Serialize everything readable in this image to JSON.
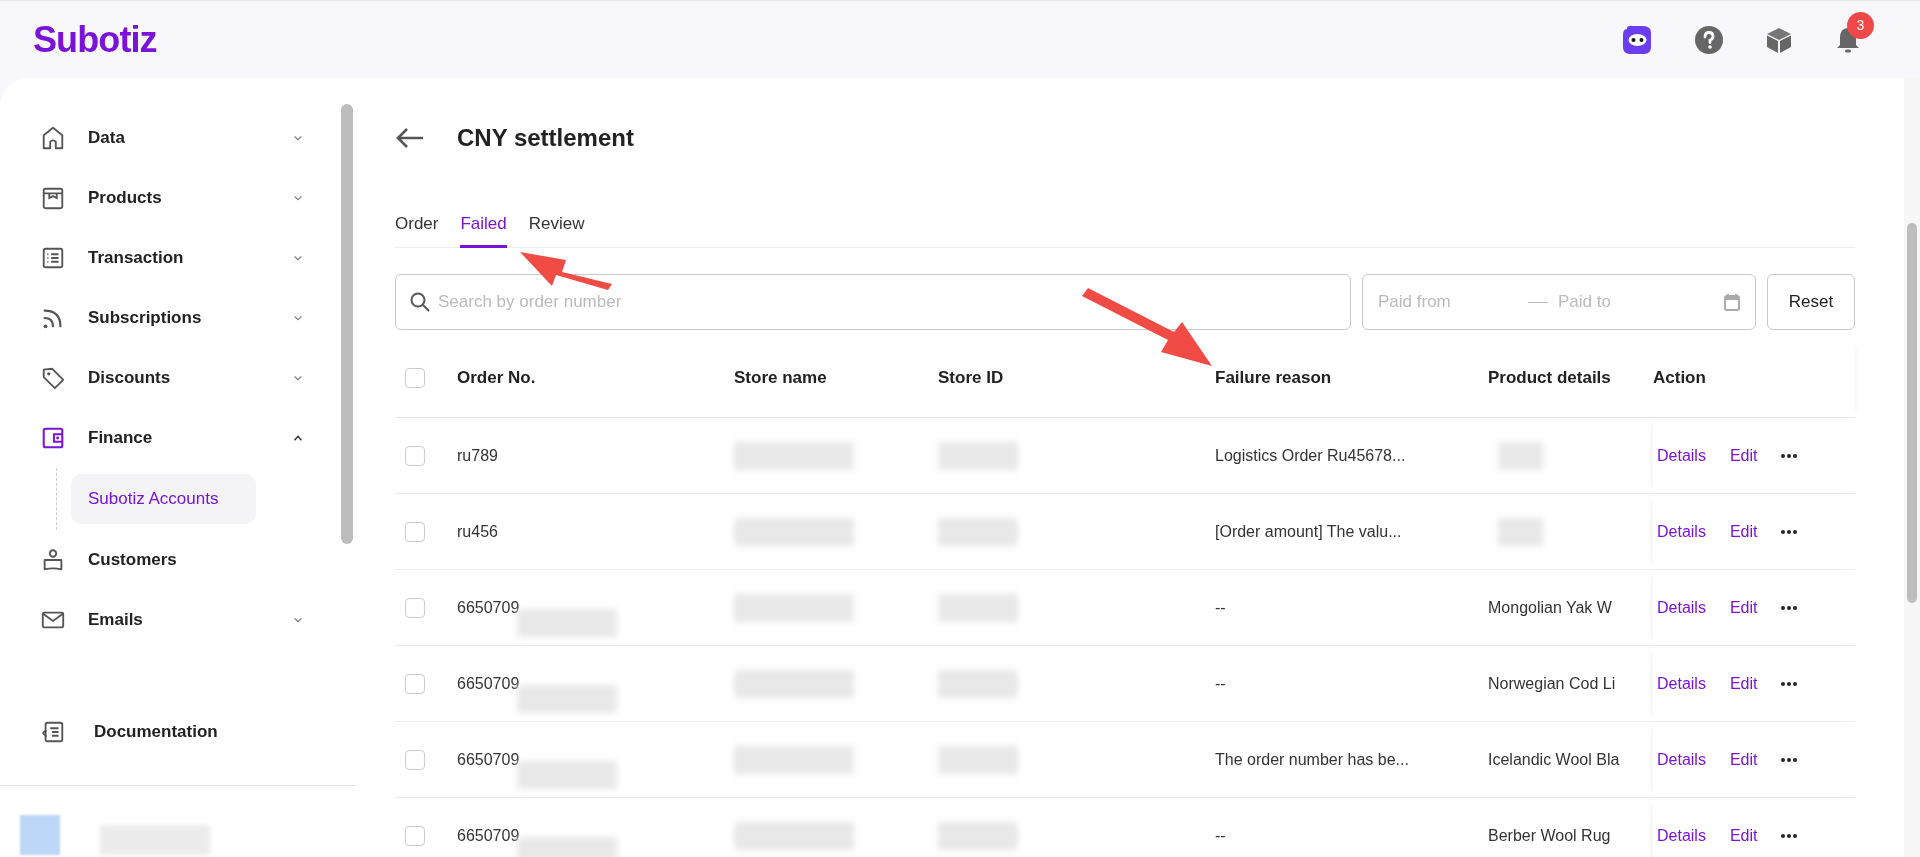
{
  "brand": "Subotiz",
  "header": {
    "notification_count": "3"
  },
  "sidebar": {
    "items": [
      {
        "label": "Data",
        "expanded": false
      },
      {
        "label": "Products",
        "expanded": false
      },
      {
        "label": "Transaction",
        "expanded": false
      },
      {
        "label": "Subscriptions",
        "expanded": false
      },
      {
        "label": "Discounts",
        "expanded": false
      },
      {
        "label": "Finance",
        "expanded": true,
        "children": [
          {
            "label": "Subotiz Accounts",
            "selected": true
          }
        ]
      },
      {
        "label": "Customers"
      },
      {
        "label": "Emails",
        "expanded": false
      }
    ],
    "footer_item": {
      "label": "Documentation"
    }
  },
  "page": {
    "title": "CNY settlement",
    "tabs": [
      {
        "label": "Order",
        "selected": false
      },
      {
        "label": "Failed",
        "selected": true
      },
      {
        "label": "Review",
        "selected": false
      }
    ],
    "search": {
      "placeholder": "Search by order number"
    },
    "date_range": {
      "start_placeholder": "Paid from",
      "end_placeholder": "Paid to"
    },
    "reset_button": "Reset"
  },
  "table": {
    "all_selected": false,
    "columns": [
      "Order No.",
      "Store name",
      "Store ID",
      "Failure reason",
      "Product details",
      "Action"
    ],
    "rows": [
      {
        "selected": false,
        "order_no": "ru789",
        "order_redacted": false,
        "failure_reason": "Logistics Order Ru45678...",
        "product_details": "",
        "actions": [
          "Details",
          "Edit"
        ]
      },
      {
        "selected": false,
        "order_no": "ru456",
        "order_redacted": false,
        "failure_reason": "[Order amount] The valu...",
        "product_details": "",
        "actions": [
          "Details",
          "Edit"
        ]
      },
      {
        "selected": false,
        "order_no": "6650709",
        "order_redacted": true,
        "failure_reason": "--",
        "product_details": "Mongolian Yak W",
        "actions": [
          "Details",
          "Edit"
        ]
      },
      {
        "selected": false,
        "order_no": "6650709",
        "order_redacted": true,
        "failure_reason": "--",
        "product_details": "Norwegian Cod Li",
        "actions": [
          "Details",
          "Edit"
        ]
      },
      {
        "selected": false,
        "order_no": "6650709",
        "order_redacted": true,
        "failure_reason": "The order number has be...",
        "product_details": "Icelandic Wool Bla",
        "actions": [
          "Details",
          "Edit"
        ]
      },
      {
        "selected": false,
        "order_no": "6650709",
        "order_redacted": true,
        "failure_reason": "--",
        "product_details": "Berber Wool Rug",
        "actions": [
          "Details",
          "Edit"
        ]
      }
    ]
  }
}
